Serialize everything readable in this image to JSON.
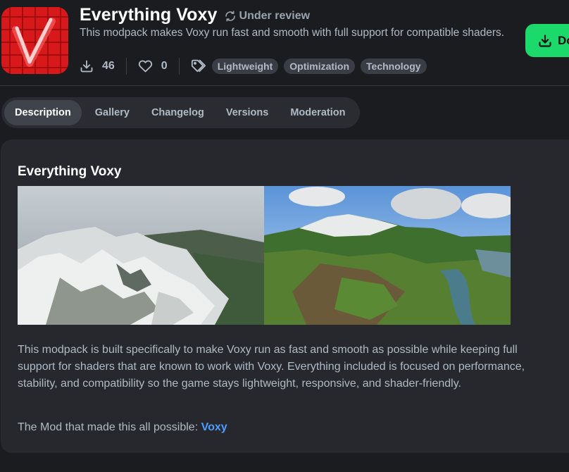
{
  "project": {
    "title": "Everything Voxy",
    "status": "Under review",
    "summary": "This modpack makes Voxy run fast and smooth with full support for compatible shaders.",
    "downloads": "46",
    "follows": "0",
    "tags": [
      "Lightweight",
      "Optimization",
      "Technology"
    ],
    "download_label": "Do",
    "logo_letter": "V"
  },
  "tabs": [
    {
      "label": "Description",
      "active": true
    },
    {
      "label": "Gallery"
    },
    {
      "label": "Changelog"
    },
    {
      "label": "Versions"
    },
    {
      "label": "Moderation"
    }
  ],
  "content": {
    "heading": "Everything Voxy",
    "body": "This modpack is built specifically to make Voxy run as fast and smooth as possible while keeping full support for shaders that are known to work with Voxy. Everything included is focused on performance, stability, and compatibility so the game stays lightweight, responsive, and shader-friendly.",
    "credit_prefix": "The Mod that made this all possible:",
    "credit_link": "Voxy"
  },
  "colors": {
    "background": "#1b1c20",
    "card": "#26282e",
    "accent_green": "#1bd96a",
    "link_blue": "#4f9cff",
    "logo_red": "#d21a1a"
  }
}
